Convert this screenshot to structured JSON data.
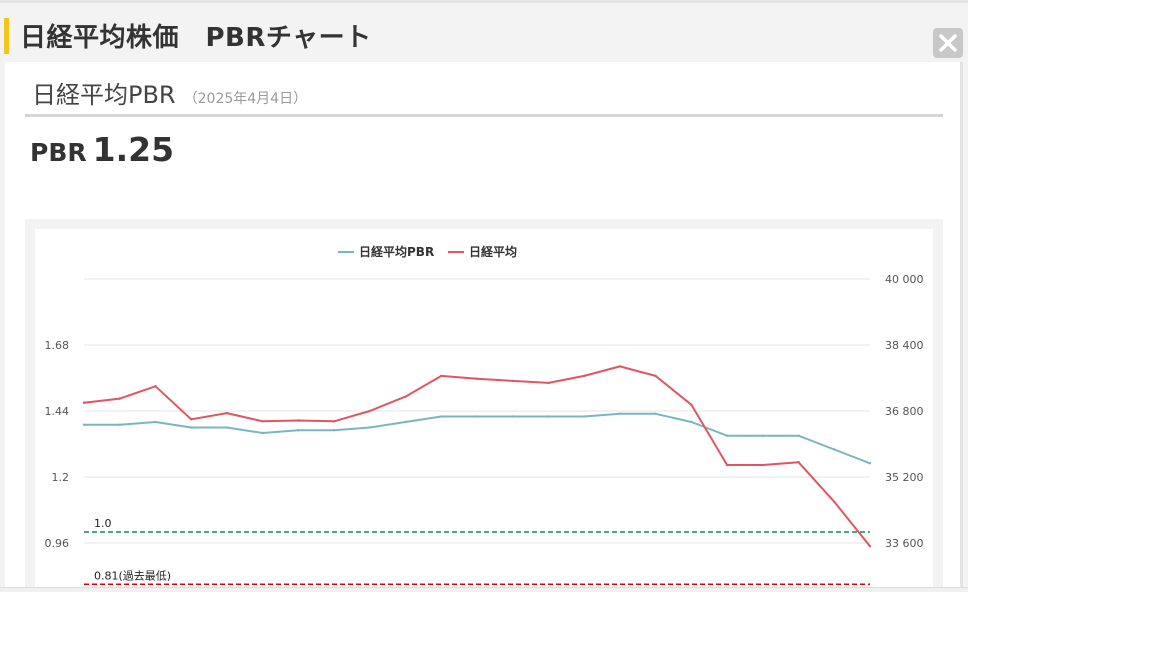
{
  "dialog": {
    "title": "日経平均株価　PBRチャート",
    "close_icon": "close-x-icon"
  },
  "section": {
    "title": "日経平均PBR",
    "date": "（2025年4月4日）"
  },
  "pbr": {
    "label": "PBR",
    "value": "1.25"
  },
  "chart_data": {
    "type": "line",
    "legend_position": "top-center",
    "grid": true,
    "series": [
      {
        "name": "日経平均PBR",
        "axis": "left",
        "color": "#7ab6c2",
        "values": [
          1.39,
          1.39,
          1.4,
          1.38,
          1.38,
          1.36,
          1.37,
          1.37,
          1.38,
          1.4,
          1.42,
          1.42,
          1.42,
          1.42,
          1.42,
          1.43,
          1.43,
          1.4,
          1.35,
          1.35,
          1.35,
          1.3,
          1.25
        ]
      },
      {
        "name": "日経平均",
        "axis": "right",
        "color": "#e05560",
        "values": [
          37000,
          37100,
          37400,
          36600,
          36750,
          36550,
          36570,
          36550,
          36800,
          37150,
          37650,
          37580,
          37530,
          37480,
          37650,
          37880,
          37650,
          36950,
          35490,
          35490,
          35560,
          34600,
          33520
        ]
      }
    ],
    "y_left": {
      "ticks": [
        "1.68",
        "1.44",
        "1.2",
        "0.96"
      ],
      "range": [
        0.72,
        1.92
      ]
    },
    "y_right": {
      "ticks": [
        "40 000",
        "38 400",
        "36 800",
        "35 200",
        "33 600"
      ],
      "range": [
        32000,
        40000
      ]
    },
    "reference_lines": [
      {
        "value": 1.0,
        "label": "1.0",
        "color": "#138a5a"
      },
      {
        "value": 0.81,
        "label": "0.81(過去最低)",
        "color": "#dd0000"
      }
    ]
  }
}
